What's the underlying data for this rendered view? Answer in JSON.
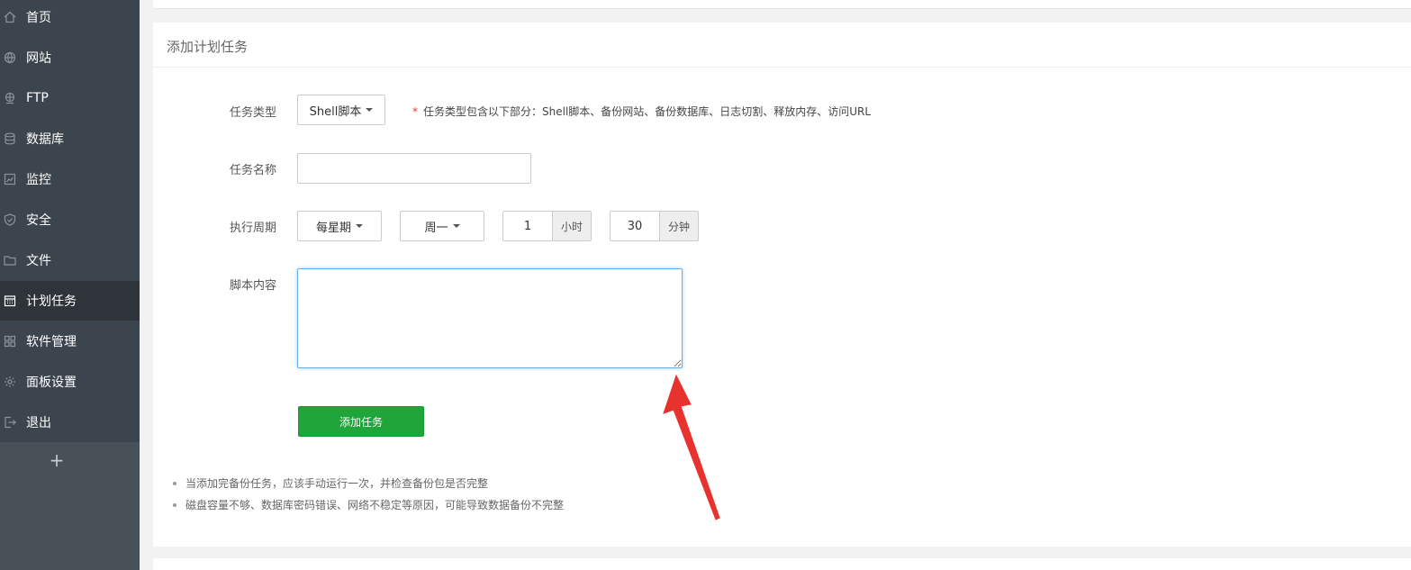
{
  "sidebar": {
    "items": [
      {
        "label": "首页",
        "icon": "home-icon"
      },
      {
        "label": "网站",
        "icon": "globe-icon"
      },
      {
        "label": "FTP",
        "icon": "ftp-icon"
      },
      {
        "label": "数据库",
        "icon": "database-icon"
      },
      {
        "label": "监控",
        "icon": "monitor-icon"
      },
      {
        "label": "安全",
        "icon": "shield-icon"
      },
      {
        "label": "文件",
        "icon": "folder-icon"
      },
      {
        "label": "计划任务",
        "icon": "calendar-icon"
      },
      {
        "label": "软件管理",
        "icon": "apps-icon"
      },
      {
        "label": "面板设置",
        "icon": "gear-icon"
      },
      {
        "label": "退出",
        "icon": "logout-icon"
      }
    ],
    "active_index": 7,
    "add_label": "+"
  },
  "card": {
    "title": "添加计划任务"
  },
  "form": {
    "task_type_label": "任务类型",
    "task_type_value": "Shell脚本",
    "task_type_hint_star": "*",
    "task_type_hint": "任务类型包含以下部分：Shell脚本、备份网站、备份数据库、日志切割、释放内存、访问URL",
    "task_name_label": "任务名称",
    "task_name_value": "",
    "period_label": "执行周期",
    "period_value": "每星期",
    "weekday_value": "周一",
    "hour_value": "1",
    "hour_unit": "小时",
    "minute_value": "30",
    "minute_unit": "分钟",
    "script_label": "脚本内容",
    "script_value": "",
    "submit_label": "添加任务"
  },
  "notes": [
    "当添加完备份任务，应该手动运行一次，并检查备份包是否完整",
    "磁盘容量不够、数据库密码错误、网络不稳定等原因，可能导致数据备份不完整"
  ],
  "colors": {
    "sidebar_bg": "#3c444d",
    "sidebar_active": "#2e3439",
    "primary_button": "#20a53a",
    "annotation_arrow": "#e8322e"
  }
}
